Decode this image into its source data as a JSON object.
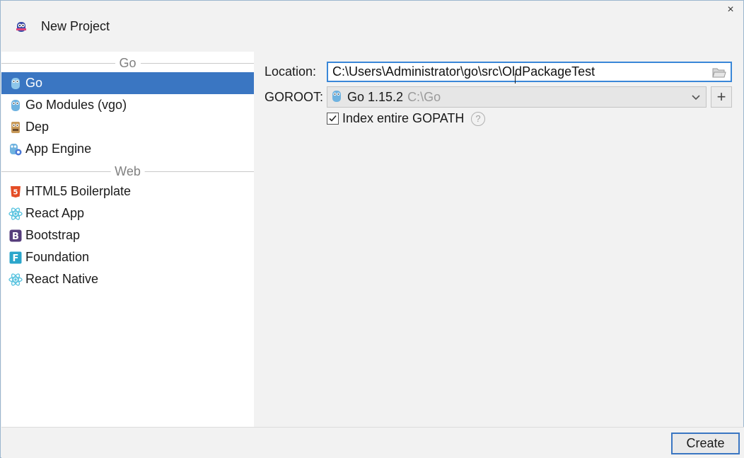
{
  "window": {
    "title": "New Project",
    "close_glyph": "×",
    "accent_color": "#3a76c2"
  },
  "sidebar": {
    "groups": [
      {
        "label": "Go",
        "items": [
          {
            "label": "Go",
            "icon": "gopher-icon",
            "selected": true
          },
          {
            "label": "Go Modules (vgo)",
            "icon": "gopher-icon"
          },
          {
            "label": "Dep",
            "icon": "dep-icon"
          },
          {
            "label": "App Engine",
            "icon": "app-engine-icon"
          }
        ]
      },
      {
        "label": "Web",
        "items": [
          {
            "label": "HTML5 Boilerplate",
            "icon": "html5-icon"
          },
          {
            "label": "React App",
            "icon": "react-icon"
          },
          {
            "label": "Bootstrap",
            "icon": "bootstrap-icon"
          },
          {
            "label": "Foundation",
            "icon": "foundation-icon"
          },
          {
            "label": "React Native",
            "icon": "react-icon"
          }
        ]
      }
    ]
  },
  "form": {
    "location_label": "Location:",
    "location_value": "C:\\Users\\Administrator\\go\\src\\OldPackageTest",
    "goroot_label": "GOROOT:",
    "goroot_version": "Go 1.15.2",
    "goroot_path": "C:\\Go",
    "add_glyph": "+",
    "index_gopath_label": "Index entire GOPATH",
    "index_gopath_checked": true,
    "help_glyph": "?"
  },
  "footer": {
    "create_label": "Create"
  }
}
